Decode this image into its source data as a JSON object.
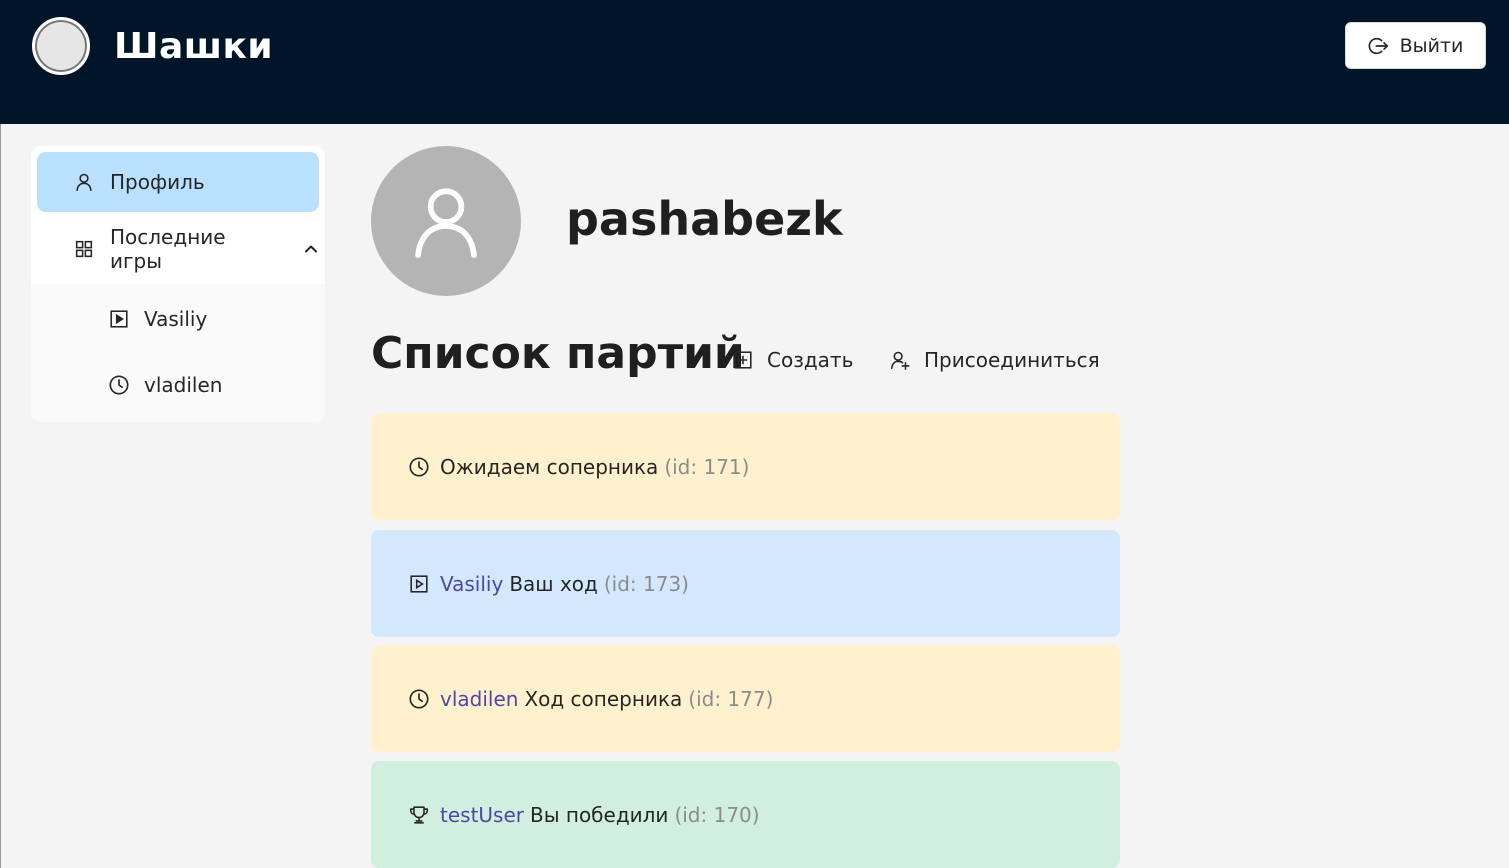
{
  "header": {
    "title": "Шашки",
    "logout_label": "Выйти",
    "logo_icon": "logo-circle",
    "background": "#00152a"
  },
  "sidebar": {
    "profile_label": "Профиль",
    "recent_games_label": "Последние игры",
    "recent_games_expanded": true,
    "sub_items": [
      {
        "label": "Vasiliy",
        "icon": "play-square-icon"
      },
      {
        "label": "vladilen",
        "icon": "clock-icon"
      }
    ],
    "active_color": "#bae0ff"
  },
  "profile": {
    "username": "pashabezk"
  },
  "games": {
    "title": "Список партий",
    "create_label": "Создать",
    "join_label": "Присоединиться",
    "items": [
      {
        "status_icon": "clock-icon",
        "opponent": "",
        "status": "Ожидаем соперника",
        "id_text": "(id: 171)",
        "color": "#fff1cd"
      },
      {
        "status_icon": "play-square-icon",
        "opponent": "Vasiliy",
        "status": "Ваш ход",
        "id_text": "(id: 173)",
        "color": "#d3e8fd"
      },
      {
        "status_icon": "clock-icon",
        "opponent": "vladilen",
        "status": "Ход соперника",
        "id_text": "(id: 177)",
        "color": "#fff1cd"
      },
      {
        "status_icon": "trophy-icon",
        "opponent": "testUser",
        "status": "Вы победили",
        "id_text": "(id: 170)",
        "color": "#d0efdf"
      }
    ]
  }
}
